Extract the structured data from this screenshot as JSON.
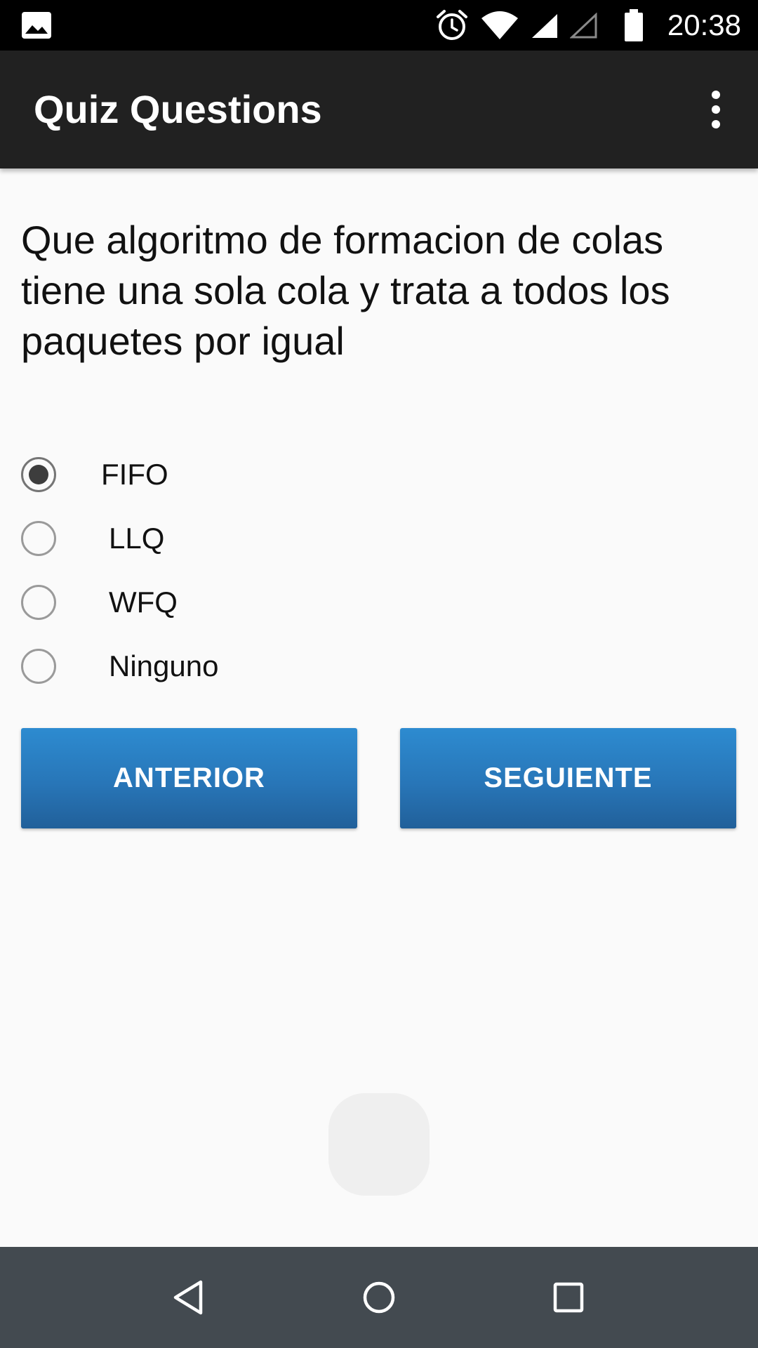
{
  "status_bar": {
    "time": "20:38",
    "icons": [
      "gallery-icon",
      "alarm-icon",
      "wifi-icon",
      "cell-signal-icon",
      "cell-signal-empty-icon",
      "battery-icon"
    ]
  },
  "app_bar": {
    "title": "Quiz Questions",
    "overflow_icon": "more-vert-icon"
  },
  "question": {
    "text": "Que algoritmo de formacion de colas tiene una sola cola y trata a todos los paquetes por igual"
  },
  "options": [
    {
      "label": "FIFO",
      "selected": true
    },
    {
      "label": "LLQ",
      "selected": false
    },
    {
      "label": "WFQ",
      "selected": false
    },
    {
      "label": "Ninguno",
      "selected": false
    }
  ],
  "buttons": {
    "previous": "ANTERIOR",
    "next": "SEGUIENTE"
  },
  "colors": {
    "status_bar": "#000000",
    "app_bar": "#212121",
    "background": "#fafafa",
    "button": "#2a7fc4",
    "nav_bar": "#434a50"
  },
  "nav_bar": {
    "icons": [
      "back-icon",
      "home-icon",
      "recents-icon"
    ]
  }
}
